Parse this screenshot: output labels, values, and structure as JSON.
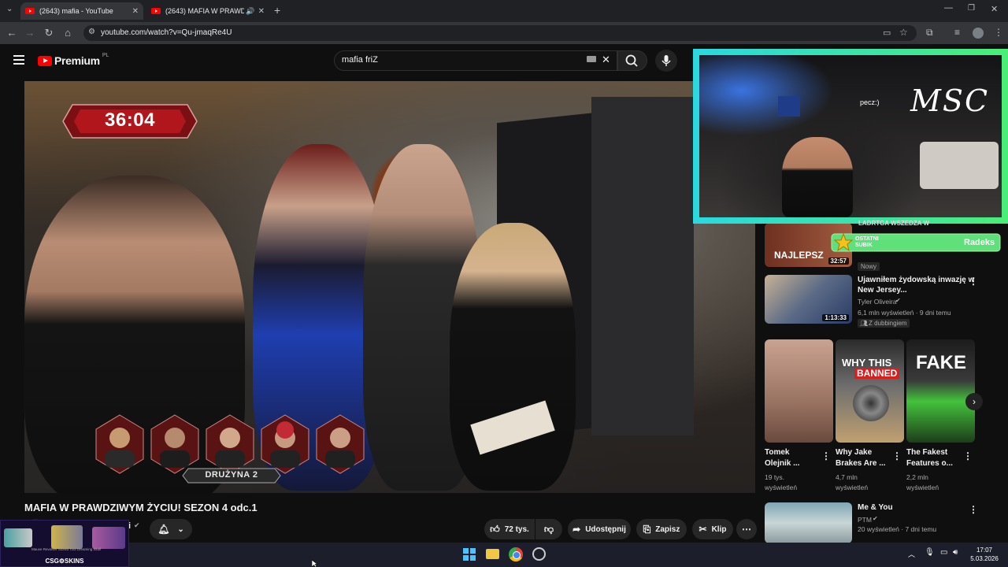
{
  "browser": {
    "tabs": [
      {
        "title": "(2643) mafia - YouTube"
      },
      {
        "title": "(2643) MAFIA W PRAWDZIWYM ŻYCIU! SEZON 4 odc.1"
      }
    ],
    "url": "youtube.com/watch?v=Qu-jmaqRe4U"
  },
  "youtube": {
    "logo_word": "Premium",
    "country_code": "PL",
    "search_value": "mafia friZ"
  },
  "video": {
    "timer": "36:04",
    "team_label": "DRUŻYNA 2",
    "title": "MAFIA W PRAWDZIWYM ŻYCIU! SEZON 4 odc.1",
    "channel_fragment": "i",
    "likes": "72 tys.",
    "share_label": "Udostępnij",
    "save_label": "Zapisz",
    "clip_label": "Klip"
  },
  "overlay": {
    "cam_logo": "MSC",
    "cam_note": "pecz:)",
    "sub_label_line1": "OSTATNI",
    "sub_label_line2": "SUBIK",
    "sub_name": "Radeks",
    "partial_heading": "LADRTGA WSZEDZA W"
  },
  "sidebar": {
    "item1": {
      "duration": "32:57",
      "badge": "Nowy",
      "thumb_text": "NAJLEPSZ"
    },
    "item2": {
      "title_line1": "Ujawniłem żydowską inwazję w",
      "title_line2": "New Jersey...",
      "channel": "Tyler Oliveira",
      "meta": "6,1 mln wyświetleń · 9 dni temu",
      "badge": "Z dubbingiem",
      "duration": "1:13:33"
    },
    "shorts": [
      {
        "title_line1": "Tomek",
        "title_line2": "Olejnik ...",
        "views": "19 tys.",
        "views2": "wyświetleń"
      },
      {
        "title_line1": "Why Jake",
        "title_line2": "Brakes Are ...",
        "views": "4,7 mln",
        "views2": "wyświetleń",
        "thumb_text1": "WHY THIS",
        "thumb_text2": "BANNED"
      },
      {
        "title_line1": "The Fakest",
        "title_line2": "Features o...",
        "views": "2,2 mln",
        "views2": "wyświetleń",
        "thumb_text1": "FAKE"
      }
    ],
    "item3": {
      "title": "Me & You",
      "channel": "PTM",
      "meta": "20 wyświetleń · 7 dni temu"
    }
  },
  "promo": {
    "text": "CSG⚙SKINS",
    "items": "Mauve Revolver   Stored Tool   Dreaming Skull"
  },
  "taskbar": {
    "time": "17:07",
    "date": "5.03.2026"
  },
  "colors": {
    "brand_red": "#ff0000",
    "overlay_cyan": "#29d9e0",
    "overlay_green": "#49ee77"
  }
}
